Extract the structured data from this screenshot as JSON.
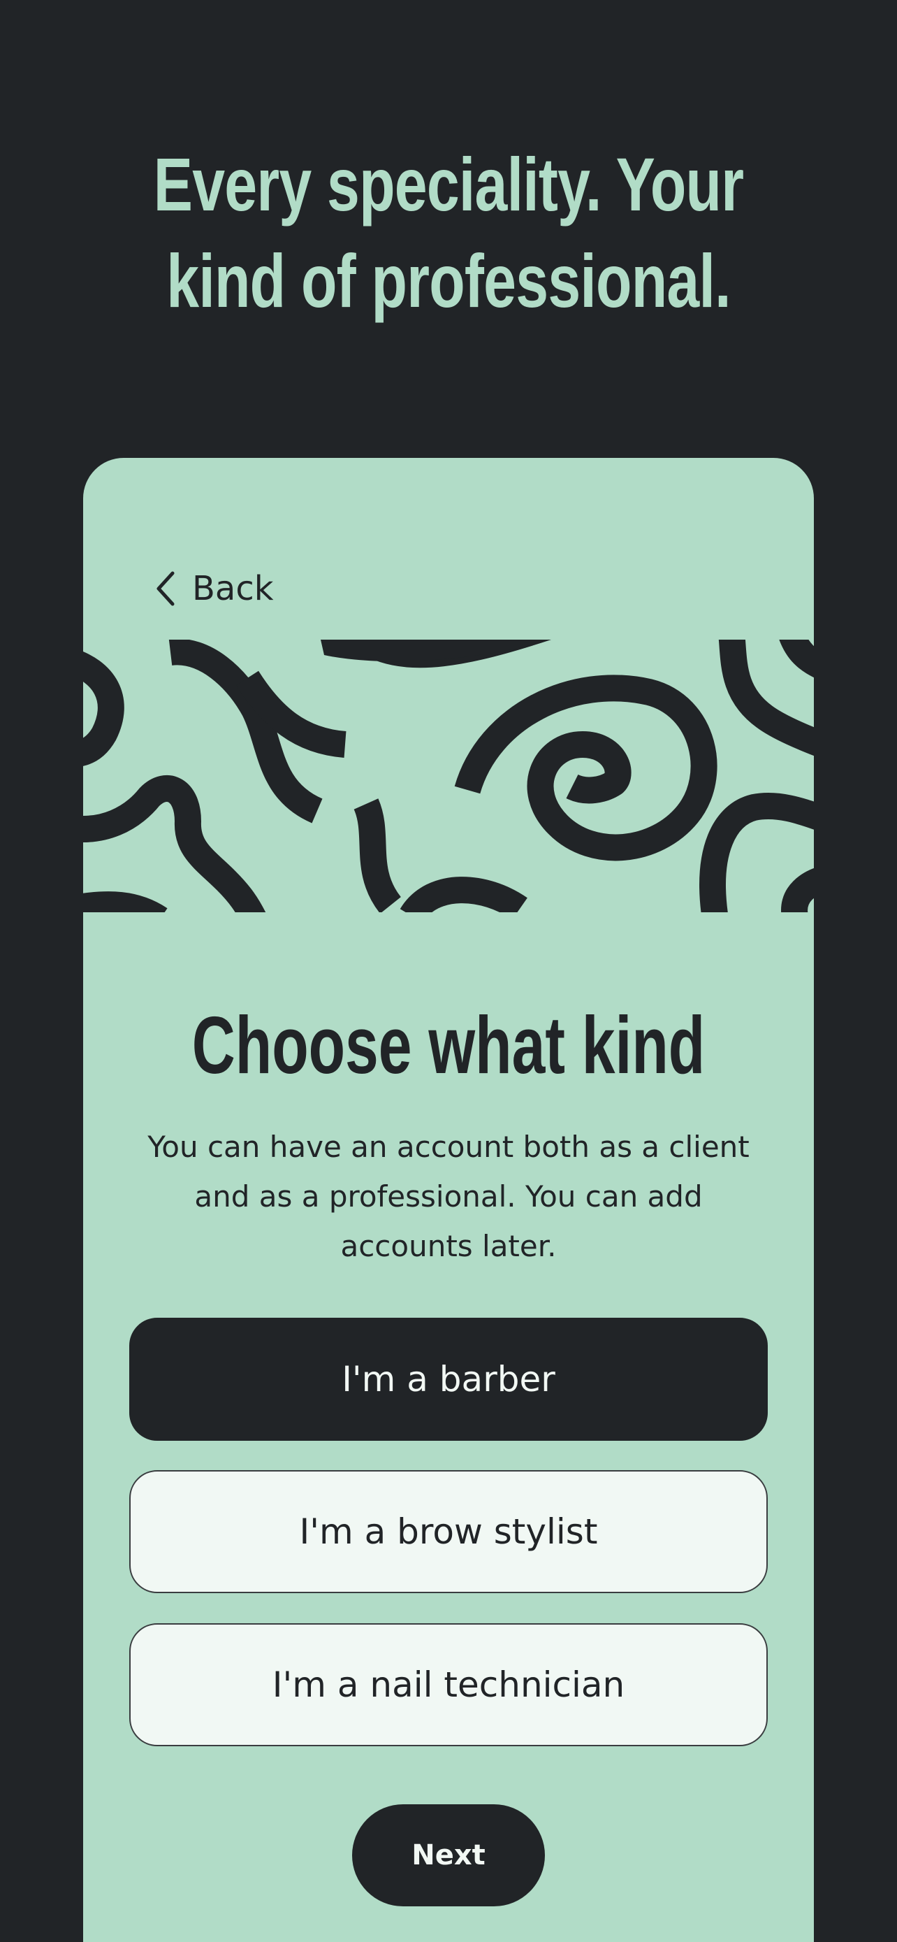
{
  "colors": {
    "background": "#212427",
    "accent": "#b1dcc7",
    "option_light": "#f1f8f4"
  },
  "hero": {
    "line1": "Every speciality. Your",
    "line2": "kind of professional."
  },
  "nav": {
    "back_label": "Back",
    "back_icon": "chevron-left-icon"
  },
  "card": {
    "heading": "Choose what kind",
    "description": "You can have an account both as a client and as a professional. You can add accounts later."
  },
  "options": [
    {
      "label": "I'm a barber",
      "selected": true
    },
    {
      "label": "I'm a brow stylist",
      "selected": false
    },
    {
      "label": "I'm a nail technician",
      "selected": false
    }
  ],
  "footer": {
    "next_label": "Next"
  }
}
